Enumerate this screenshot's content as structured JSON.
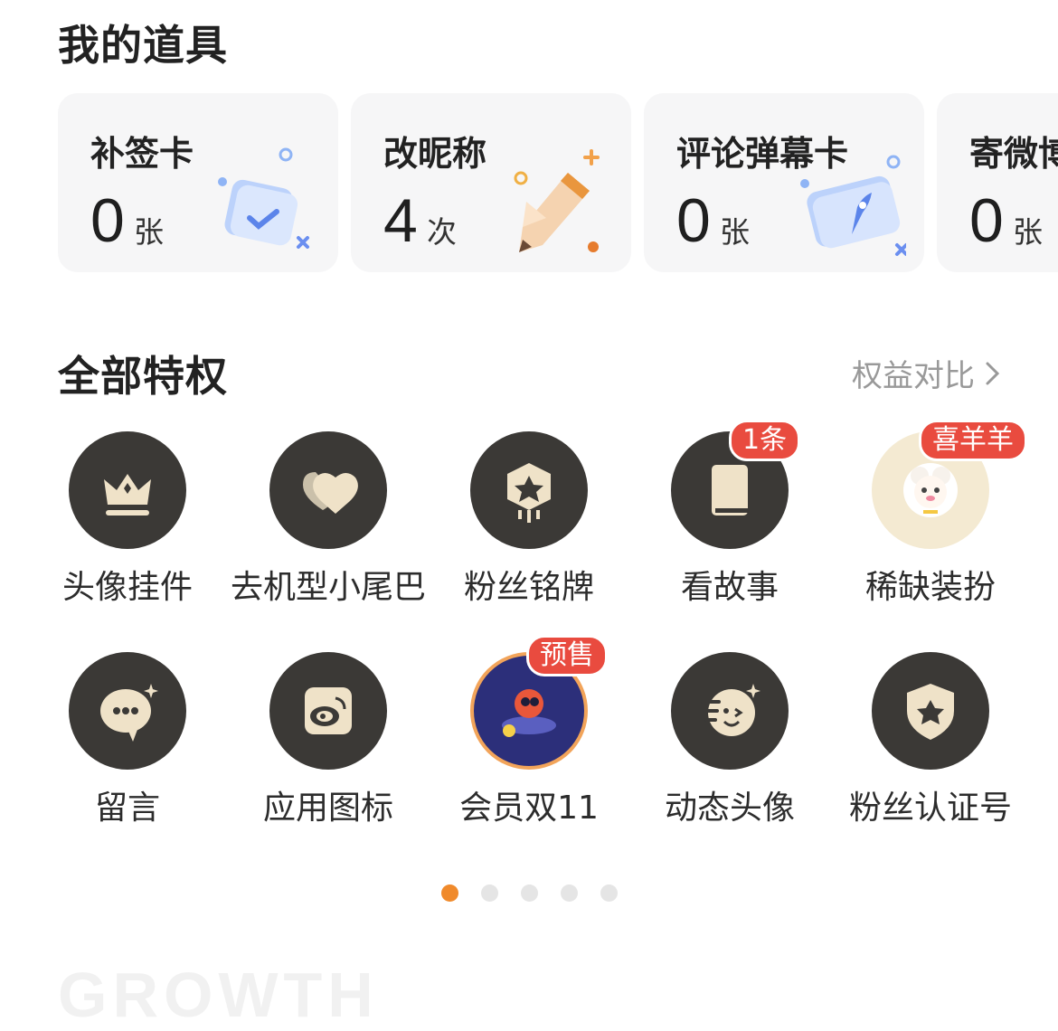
{
  "props_section": {
    "title": "我的道具",
    "cards": [
      {
        "name": "补签卡",
        "count": "0",
        "unit": "张",
        "icon": "calendar-check-icon"
      },
      {
        "name": "改昵称",
        "count": "4",
        "unit": "次",
        "icon": "pencil-icon"
      },
      {
        "name": "评论弹幕卡",
        "count": "0",
        "unit": "张",
        "icon": "rocket-ticket-icon"
      },
      {
        "name": "寄微博",
        "count": "0",
        "unit": "张",
        "icon": "mail-icon"
      }
    ]
  },
  "privileges_section": {
    "title": "全部特权",
    "compare_link": "权益对比",
    "items": [
      {
        "label": "头像挂件",
        "icon": "crown-icon",
        "badge": null
      },
      {
        "label": "去机型小尾巴",
        "icon": "hearts-icon",
        "badge": null
      },
      {
        "label": "粉丝铭牌",
        "icon": "star-badge-icon",
        "badge": null
      },
      {
        "label": "看故事",
        "icon": "book-icon",
        "badge": "1条"
      },
      {
        "label": "稀缺装扮",
        "icon": "sheep-avatar-icon",
        "badge": "喜羊羊"
      },
      {
        "label": "留言",
        "icon": "chat-bubble-icon",
        "badge": null
      },
      {
        "label": "应用图标",
        "icon": "weibo-icon",
        "badge": null
      },
      {
        "label": "会员双11",
        "icon": "rocket-character-icon",
        "badge": "预售"
      },
      {
        "label": "动态头像",
        "icon": "wink-face-icon",
        "badge": null
      },
      {
        "label": "粉丝认证号",
        "icon": "shield-star-icon",
        "badge": null
      }
    ]
  },
  "pagination": {
    "total": 5,
    "active": 0
  },
  "footer_heading": "GROWTH",
  "colors": {
    "accent": "#f08a2b",
    "badge": "#e94b3f",
    "icon_bg": "#3b3936",
    "icon_fg": "#efe2c8"
  }
}
